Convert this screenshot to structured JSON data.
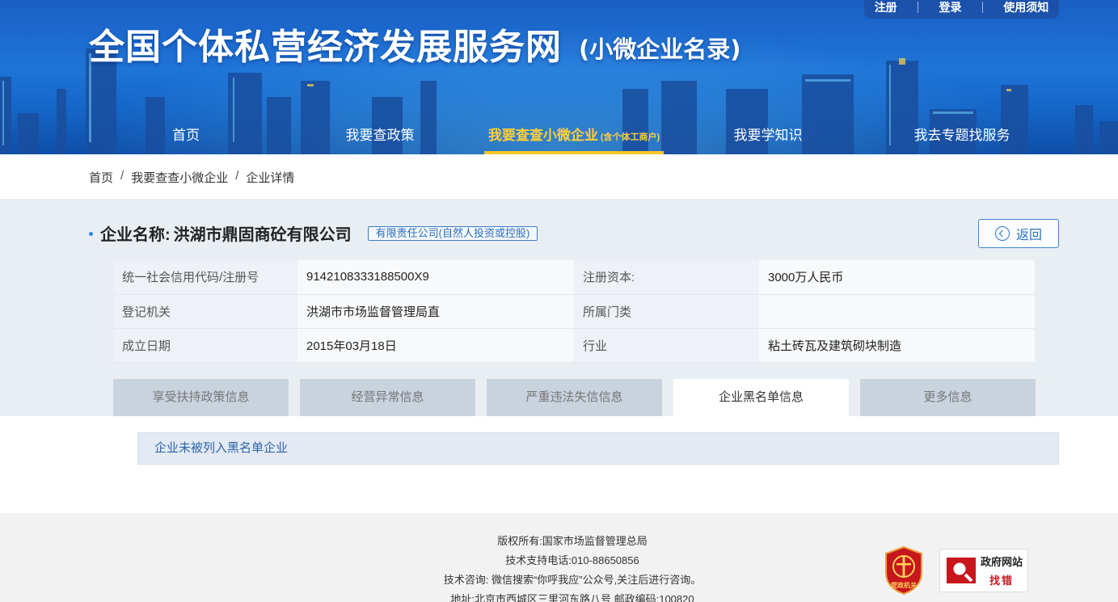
{
  "header": {
    "title": "全国个体私营经济发展服务网",
    "subtitle": "(小微企业名录)",
    "top_links": [
      "注册",
      "登录",
      "使用须知"
    ]
  },
  "nav": {
    "items": [
      {
        "label": "首页"
      },
      {
        "label": "我要查政策"
      },
      {
        "label": "我要查查小微企业",
        "extra": "(含个体工商户)",
        "active": true
      },
      {
        "label": "我要学知识"
      },
      {
        "label": "我去专题找服务"
      }
    ]
  },
  "breadcrumb": [
    "首页",
    "我要查查小微企业",
    "企业详情"
  ],
  "company": {
    "label": "企业名称:",
    "name": "洪湖市鼎固商砼有限公司",
    "type_tag": "有限责任公司(自然人投资或控股)",
    "back_label": "返回"
  },
  "info_rows": [
    {
      "k1": "统一社会信用代码/注册号",
      "v1": "9142108333188500X9",
      "k2": "注册资本:",
      "v2": "3000万人民币"
    },
    {
      "k1": "登记机关",
      "v1": "洪湖市市场监督管理局直",
      "k2": "所属门类",
      "v2": ""
    },
    {
      "k1": "成立日期",
      "v1": "2015年03月18日",
      "k2": "行业",
      "v2": "粘土砖瓦及建筑砌块制造"
    }
  ],
  "tabs": [
    {
      "label": "享受扶持政策信息"
    },
    {
      "label": "经营异常信息"
    },
    {
      "label": "严重违法失信信息"
    },
    {
      "label": "企业黑名单信息",
      "active": true
    },
    {
      "label": "更多信息"
    }
  ],
  "result_text": "企业未被列入黑名单企业",
  "footer": {
    "lines": [
      "版权所有:国家市场监督管理总局",
      "技术支持电话:010-88650856",
      "技术咨询: 微信搜索“你呼我应”公众号,关注后进行咨询。",
      "地址:北京市西城区三里河东路八号 邮政编码:100820"
    ],
    "party_badge_text": "党政机关",
    "gov_badge_line1": "政府网站",
    "gov_badge_line2": "找错"
  },
  "colors": {
    "header_blue": "#1f74d8",
    "active_nav": "#ffce3a",
    "link_blue": "#2c74c8",
    "badge_red": "#c8161d"
  }
}
